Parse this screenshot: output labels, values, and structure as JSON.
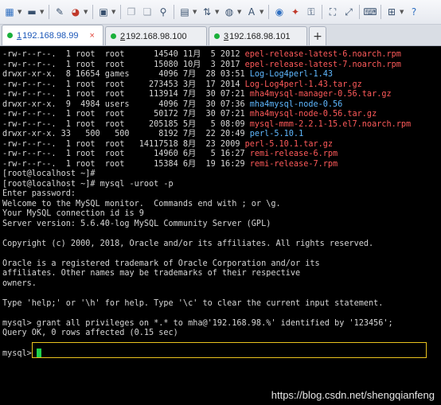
{
  "toolbar": {
    "icons": [
      "new-session-icon",
      "open-folder-icon",
      "pencil-icon",
      "palette-icon",
      "settings-icon",
      "copy-icon",
      "paste-icon",
      "find-icon",
      "print-icon",
      "transfer-icon",
      "globe-icon",
      "font-icon",
      "record-icon",
      "script-icon",
      "fullscreen-icon",
      "resize-icon",
      "lock-icon",
      "keyboard-icon",
      "add-icon",
      "help-icon"
    ]
  },
  "tabs": [
    {
      "num": "1",
      "label": " 192.168.98.99",
      "close": "×",
      "active": true
    },
    {
      "num": "2",
      "label": " 192.168.98.100",
      "close": "×",
      "active": false
    },
    {
      "num": "3",
      "label": " 192.168.98.101",
      "close": "×",
      "active": false
    }
  ],
  "tab_add": "+",
  "terminal": {
    "listing": [
      {
        "prefix": "-rw-r--r--.  1 root  root      14540 11月  5 2012 ",
        "name": "epel-release-latest-6.noarch.rpm",
        "color": "red"
      },
      {
        "prefix": "-rw-r--r--.  1 root  root      15080 10月  3 2017 ",
        "name": "epel-release-latest-7.noarch.rpm",
        "color": "red"
      },
      {
        "prefix": "drwxr-xr-x.  8 16654 games      4096 7月  28 03:51 ",
        "name": "Log-Log4perl-1.43",
        "color": "blue"
      },
      {
        "prefix": "-rw-r--r--.  1 root  root     273453 3月  17 2014 ",
        "name": "Log-Log4perl-1.43.tar.gz",
        "color": "red"
      },
      {
        "prefix": "-rw-r--r--.  1 root  root     113914 7月  30 07:21 ",
        "name": "mha4mysql-manager-0.56.tar.gz",
        "color": "red"
      },
      {
        "prefix": "drwxr-xr-x.  9  4984 users      4096 7月  30 07:36 ",
        "name": "mha4mysql-node-0.56",
        "color": "blue"
      },
      {
        "prefix": "-rw-r--r--.  1 root  root      50172 7月  30 07:21 ",
        "name": "mha4mysql-node-0.56.tar.gz",
        "color": "red"
      },
      {
        "prefix": "-rw-r--r--.  1 root  root     205185 5月   5 08:09 ",
        "name": "mysql-mmm-2.2.1-15.el7.noarch.rpm",
        "color": "red"
      },
      {
        "prefix": "drwxr-xr-x. 33   500   500      8192 7月  22 20:49 ",
        "name": "perl-5.10.1",
        "color": "blue"
      },
      {
        "prefix": "-rw-r--r--.  1 root  root   14117518 8月  23 2009 ",
        "name": "perl-5.10.1.tar.gz",
        "color": "red"
      },
      {
        "prefix": "-rw-r--r--.  1 root  root      14960 6月   5 16:27 ",
        "name": "remi-release-6.rpm",
        "color": "red"
      },
      {
        "prefix": "-rw-r--r--.  1 root  root      15384 6月  19 16:29 ",
        "name": "remi-release-7.rpm",
        "color": "red"
      }
    ],
    "lines": [
      "[root@localhost ~]#",
      "[root@localhost ~]# mysql -uroot -p",
      "Enter password:",
      "Welcome to the MySQL monitor.  Commands end with ; or \\g.",
      "Your MySQL connection id is 9",
      "Server version: 5.6.40-log MySQL Community Server (GPL)",
      "",
      "Copyright (c) 2000, 2018, Oracle and/or its affiliates. All rights reserved.",
      "",
      "Oracle is a registered trademark of Oracle Corporation and/or its",
      "affiliates. Other names may be trademarks of their respective",
      "owners.",
      "",
      "Type 'help;' or '\\h' for help. Type '\\c' to clear the current input statement.",
      "",
      "mysql> grant all privileges on *.* to mha@'192.168.98.%' identified by '123456';",
      "Query OK, 0 rows affected (0.15 sec)",
      "",
      "mysql> "
    ]
  },
  "watermark": "https://blog.csdn.net/shengqianfeng",
  "colors": {
    "red": "#ff5a5a",
    "blue": "#5fb8ff",
    "cursor": "#1fd14b",
    "highlight": "#e9c21e"
  }
}
